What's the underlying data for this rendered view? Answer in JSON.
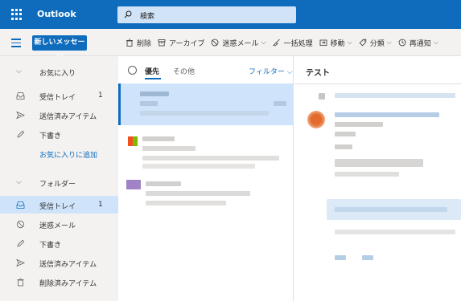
{
  "app": {
    "title": "Outlook"
  },
  "search": {
    "placeholder": "検索"
  },
  "toolbar": {
    "new_message": "新しいメッセージ",
    "actions": [
      {
        "label": "削除",
        "icon": "trash-icon",
        "dropdown": false
      },
      {
        "label": "アーカイブ",
        "icon": "archive-icon",
        "dropdown": false
      },
      {
        "label": "迷惑メール",
        "icon": "block-icon",
        "dropdown": true
      },
      {
        "label": "一括処理",
        "icon": "sweep-icon",
        "dropdown": false
      },
      {
        "label": "移動",
        "icon": "move-icon",
        "dropdown": true
      },
      {
        "label": "分類",
        "icon": "tag-icon",
        "dropdown": true
      },
      {
        "label": "再通知",
        "icon": "clock-icon",
        "dropdown": true
      }
    ]
  },
  "nav": {
    "favorites": {
      "header": "お気に入り",
      "items": [
        {
          "label": "受信トレイ",
          "count": "1",
          "icon": "inbox-icon"
        },
        {
          "label": "送信済みアイテム",
          "count": "",
          "icon": "send-icon"
        },
        {
          "label": "下書き",
          "count": "",
          "icon": "pencil-icon"
        }
      ],
      "add_link": "お気に入りに追加"
    },
    "folders": {
      "header": "フォルダー",
      "items": [
        {
          "label": "受信トレイ",
          "count": "1",
          "icon": "inbox-icon",
          "selected": true
        },
        {
          "label": "迷惑メール",
          "count": "",
          "icon": "block-icon"
        },
        {
          "label": "下書き",
          "count": "",
          "icon": "pencil-icon"
        },
        {
          "label": "送信済みアイテム",
          "count": "",
          "icon": "send-icon"
        },
        {
          "label": "削除済みアイテム",
          "count": "",
          "icon": "trash-icon"
        }
      ]
    }
  },
  "list": {
    "tab_focused": "優先",
    "tab_other": "その他",
    "filter": "フィルター"
  },
  "reading": {
    "subject": "テスト"
  },
  "colors": {
    "brand": "#0f6cbd",
    "selected": "#cfe4fa",
    "nav_bg": "#f3f2f1"
  }
}
